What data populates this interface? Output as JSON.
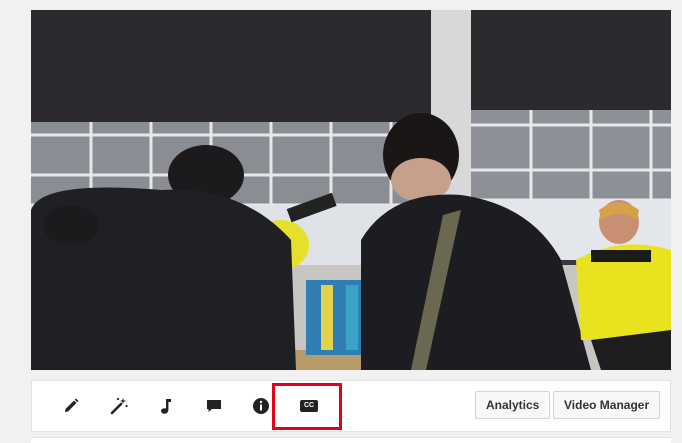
{
  "video": {
    "description_icon": "video-preview"
  },
  "toolbar": {
    "icons": [
      {
        "name": "pencil-icon"
      },
      {
        "name": "magic-wand-icon"
      },
      {
        "name": "music-note-icon"
      },
      {
        "name": "comment-icon"
      },
      {
        "name": "info-icon"
      },
      {
        "name": "cc-icon"
      }
    ],
    "cc_label": "CC",
    "analytics_label": "Analytics",
    "video_manager_label": "Video Manager",
    "highlight_color": "#e3001b"
  }
}
